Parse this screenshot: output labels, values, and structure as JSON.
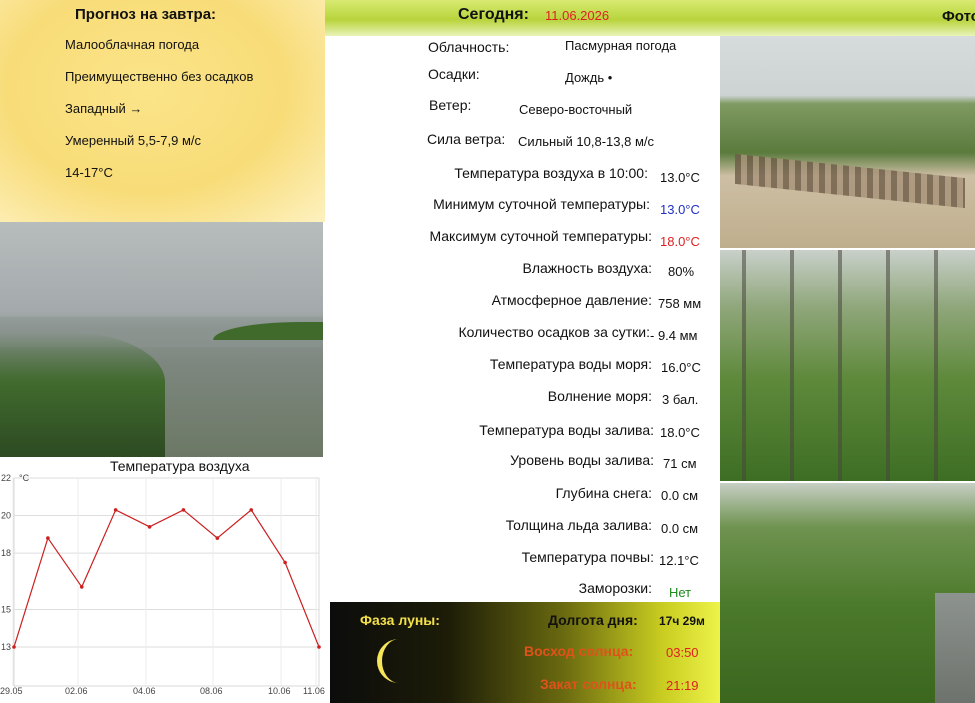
{
  "header": {
    "today_label": "Сегодня:",
    "today_date": "11.06.2026",
    "photo_label": "Фото"
  },
  "forecast": {
    "title": "Прогноз на завтра:",
    "lines": [
      "Малооблачная погода",
      "Преимущественно без осадков",
      "Западный →",
      "Умеренный 5,5-7,9 м/с",
      "14-17°C"
    ]
  },
  "params": [
    {
      "label": "Облачность:",
      "value": "Пасмурная погода"
    },
    {
      "label": "Осадки:",
      "value": "Дождь •"
    },
    {
      "label": "Ветер:",
      "value": "Северо-восточный"
    },
    {
      "label": "Сила ветра:",
      "value": "Сильный 10,8-13,8 м/с"
    },
    {
      "label": "Температура воздуха в 10:00:",
      "value": "13.0°C"
    },
    {
      "label": "Минимум суточной температуры:",
      "value": "13.0°C"
    },
    {
      "label": "Максимум суточной температуры:",
      "value": "18.0°C"
    },
    {
      "label": "Влажность воздуха:",
      "value": "80%"
    },
    {
      "label": "Атмосферное давление:",
      "value": "758 мм"
    },
    {
      "label": "Количество осадков за сутки:",
      "value": "- 9.4 мм"
    },
    {
      "label": "Температура воды моря:",
      "value": "16.0°C"
    },
    {
      "label": "Волнение моря:",
      "value": "3 бал."
    },
    {
      "label": "Температура воды залива:",
      "value": "18.0°C"
    },
    {
      "label": "Уровень воды залива:",
      "value": "71 см"
    },
    {
      "label": "Глубина снега:",
      "value": "0.0 см"
    },
    {
      "label": "Толщина льда залива:",
      "value": "0.0 см"
    },
    {
      "label": "Температура почвы:",
      "value": "12.1°C"
    },
    {
      "label": "Заморозки:",
      "value": "Нет"
    }
  ],
  "moon": {
    "title": "Фаза луны:",
    "day_length_label": "Долгота дня:",
    "day_length_value": "17ч 29м",
    "sunrise_label": "Восход солнца:",
    "sunrise_value": "03:50",
    "sunset_label": "Закат солнца:",
    "sunset_value": "21:19"
  },
  "colors": {
    "min_temp": "#2030c0",
    "max_temp": "#e02020",
    "frost": "#1d8a1d",
    "date": "#e02020",
    "chart_line": "#cc1f1f"
  },
  "chart_data": {
    "type": "line",
    "title": "Температура воздуха",
    "unit_label": "°C",
    "ylim": [
      13,
      22
    ],
    "y_ticks": [
      13,
      15,
      18,
      20,
      22
    ],
    "x_ticks": [
      "29.05",
      "02.06",
      "04.06",
      "08.06",
      "10.06",
      "11.06"
    ],
    "grid": true,
    "series": [
      {
        "values": [
          13.0,
          18.8,
          16.2,
          20.3,
          19.4,
          20.3,
          18.8,
          20.3,
          17.5,
          13.0
        ]
      }
    ]
  }
}
